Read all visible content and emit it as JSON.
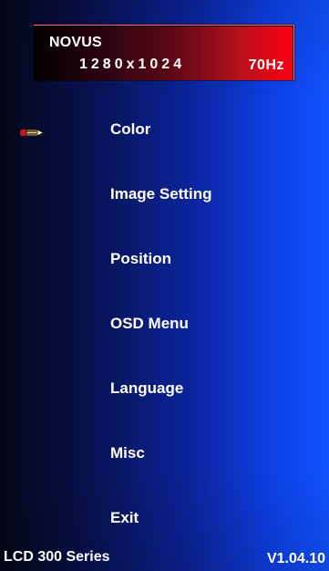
{
  "header": {
    "brand": "NOVUS",
    "resolution": "1280x1024",
    "refresh_rate": "70Hz"
  },
  "menu": {
    "selected": "Color",
    "items": [
      {
        "label": "Color"
      },
      {
        "label": "Image Setting"
      },
      {
        "label": "Position"
      },
      {
        "label": "OSD Menu"
      },
      {
        "label": "Language"
      },
      {
        "label": "Misc"
      },
      {
        "label": "Exit"
      }
    ]
  },
  "footer": {
    "series": "LCD 300 Series",
    "version": "V1.04.10"
  },
  "colors": {
    "background_left": "#030716",
    "background_right": "#1152ff",
    "header_left": "#000000",
    "header_right": "#ff0010",
    "text": "#ffffff"
  },
  "icons": {
    "selection_marker": "pencil-pointer-icon"
  }
}
